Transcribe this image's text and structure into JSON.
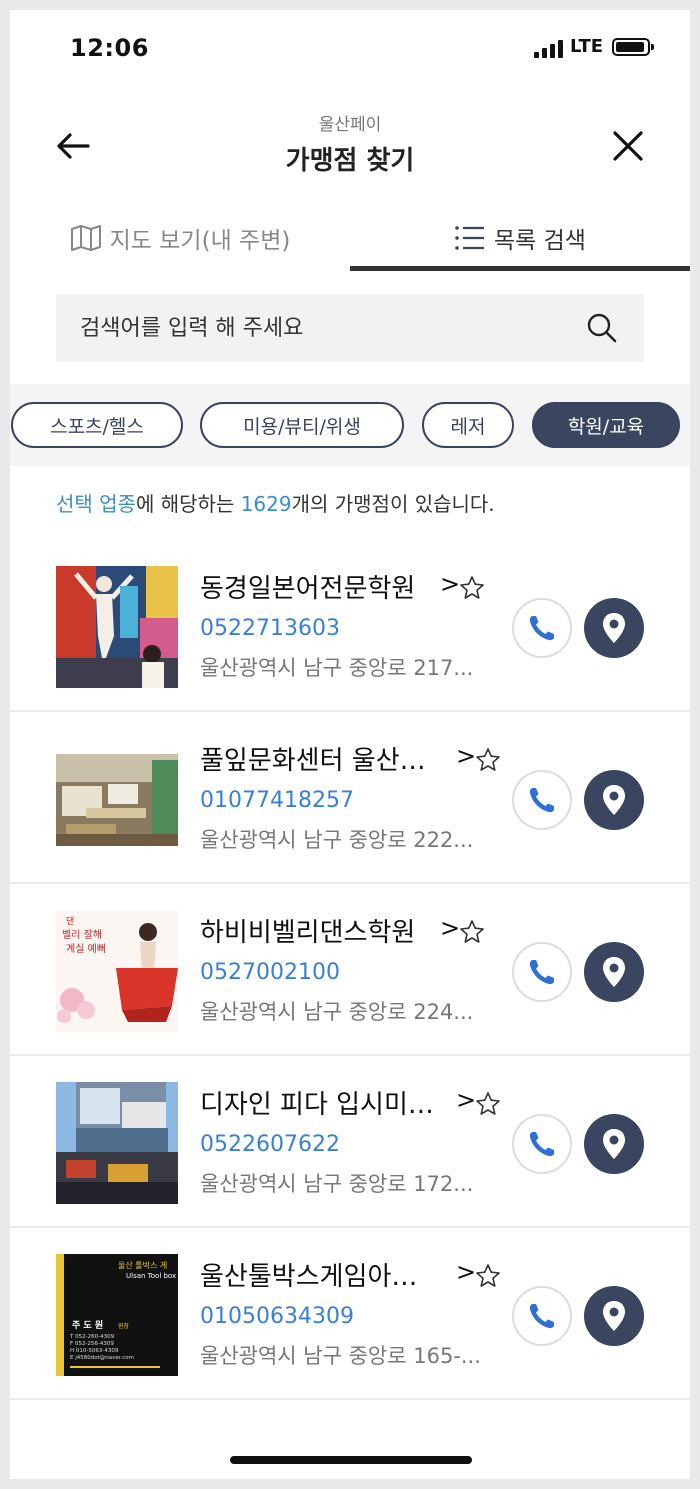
{
  "status": {
    "time": "12:06",
    "network": "LTE"
  },
  "header": {
    "subtitle": "울산페이",
    "title": "가맹점 찾기"
  },
  "tabs": {
    "map_label": "지도 보기(내 주변)",
    "list_label": "목록 검색",
    "active": "list"
  },
  "search": {
    "placeholder": "검색어를 입력 해 주세요",
    "value": ""
  },
  "categories": [
    {
      "label": "스포츠/헬스",
      "active": false
    },
    {
      "label": "미용/뷰티/위생",
      "active": false
    },
    {
      "label": "레저",
      "active": false
    },
    {
      "label": "학원/교육",
      "active": true
    }
  ],
  "result": {
    "prefix": "선택 업종",
    "mid1": "에 해당하는 ",
    "count": "1629",
    "suffix": "개의 가맹점이 있습니다."
  },
  "stores": [
    {
      "name": "동경일본어전문학원",
      "phone": "0522713603",
      "address": "울산광역시 남구 중앙로 217..."
    },
    {
      "name": "풀잎문화센터 울산…",
      "phone": "01077418257",
      "address": "울산광역시 남구 중앙로 222..."
    },
    {
      "name": "하비비벨리댄스학원",
      "phone": "0527002100",
      "address": "울산광역시 남구 중앙로 224..."
    },
    {
      "name": "디자인 피다 입시미…",
      "phone": "0522607622",
      "address": "울산광역시 남구 중앙로 172..."
    },
    {
      "name": "울산툴박스게임아…",
      "phone": "01050634309",
      "address": "울산광역시 남구 중앙로 165-..."
    }
  ],
  "thumb_texts": {
    "s3": [
      "댄",
      "벨리 잘해",
      "계실 예뻐"
    ],
    "s5": {
      "brand": "울산 툴박스 게",
      "brand_en": "Ulsan Tool box",
      "person": "주 도 원",
      "person_title": "원장",
      "contacts": [
        "T 052-260-4309",
        "F 052-256-4309",
        "H 010-5063-4309",
        "E j4580dot@naver.com"
      ]
    }
  },
  "colors": {
    "accent": "#3a4560",
    "link": "#3a7fd6",
    "highlight": "#3a8fc8"
  }
}
